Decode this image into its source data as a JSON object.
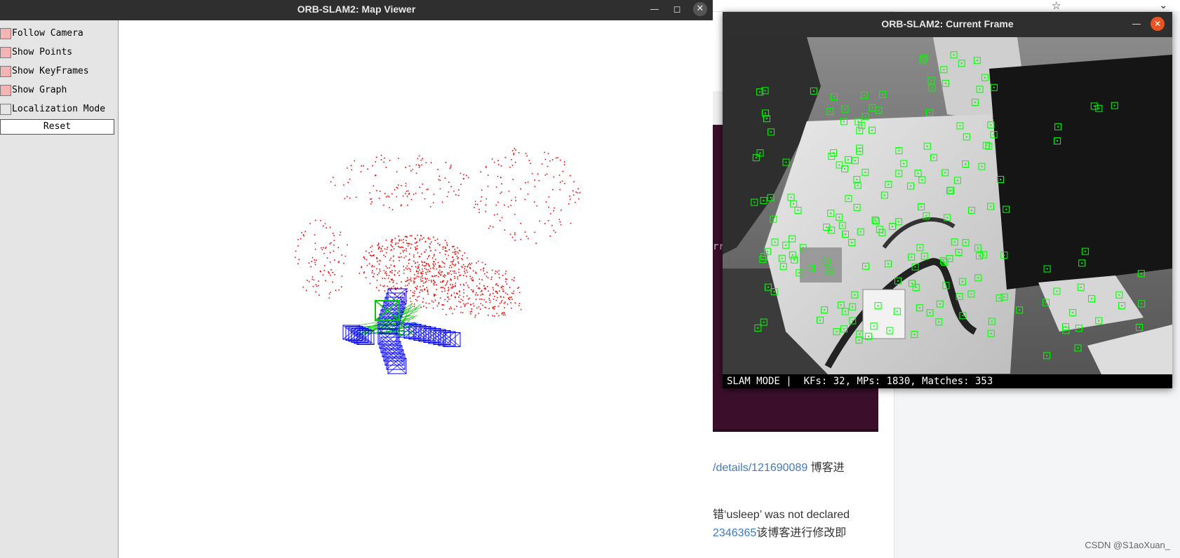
{
  "map_viewer": {
    "title": "ORB-SLAM2: Map Viewer",
    "controls": [
      {
        "label": "Follow Camera",
        "checked": true
      },
      {
        "label": "Show Points",
        "checked": true
      },
      {
        "label": "Show KeyFrames",
        "checked": true
      },
      {
        "label": "Show Graph",
        "checked": true
      },
      {
        "label": "Localization Mode",
        "checked": false
      }
    ],
    "reset_label": "Reset",
    "colors": {
      "map_points": "#ff0000",
      "keyframes": "#0000ff",
      "graph": "#00c000",
      "current_camera": "#00cc00",
      "panel_check": "#f4b4b4"
    }
  },
  "current_frame": {
    "title": "ORB-SLAM2: Current Frame",
    "status": "SLAM MODE |  KFs: 32, MPs: 1830, Matches: 353",
    "feature_color": "#00ff00"
  },
  "background": {
    "line1_link": "/details/121690089",
    "line1_text": " 博客进",
    "line2_text": "错‘usleep’ was not declared",
    "line3_link": "2346365",
    "line3_text": "该博客进行修改即",
    "terminal_fragment": "rr",
    "watermark": "CSDN @S1aoXuan_"
  }
}
